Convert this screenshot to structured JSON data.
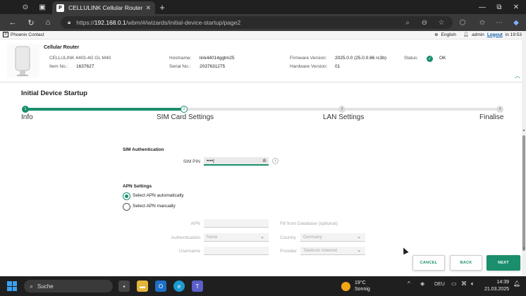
{
  "browser": {
    "tab_title": "CELLULINK Cellular Router",
    "tab_favicon": "P",
    "url_prefix": "https://",
    "url_host": "192.168.0.1",
    "url_path": "/wbm/#/wizards/initial-device-startup/page2"
  },
  "topbar": {
    "brand": "Phoenix Contact",
    "language": "English",
    "user": "admin",
    "logout": "Logout",
    "login_time": "in 19:53"
  },
  "device": {
    "title": "Cellular Router",
    "model": "CELLULINK 4403-4G GL M40",
    "item_label": "Item No.:",
    "item_value": "1637627",
    "hostname_label": "Hostname:",
    "hostname_value": "link44014ggtm25",
    "serial_label": "Serial No.:",
    "serial_value": "2037631275",
    "firmware_label": "Firmware Version:",
    "firmware_value": "2025.0.0 (25.0.0.86 rc3b)",
    "hardware_label": "Hardware Version:",
    "hardware_value": "01",
    "status_label": "Status:",
    "status_value": "OK"
  },
  "wizard": {
    "title": "Initial Device Startup",
    "progress_fraction": 0.333,
    "steps": [
      {
        "num": "1",
        "label": "Info"
      },
      {
        "num": "2",
        "label": "SIM Card Settings"
      },
      {
        "num": "3",
        "label": "LAN Settings"
      },
      {
        "num": "4",
        "label": "Finalise"
      }
    ]
  },
  "sim": {
    "section": "SIM Authentication",
    "pin_label": "SIM PIN",
    "pin_value": "••••|",
    "info": "i"
  },
  "apn": {
    "section": "APN Settings",
    "opt_auto": "Select APN automatically",
    "opt_manual": "Select APN manually",
    "apn_label": "APN",
    "apn_value": "",
    "fill_label": "Fill from Database (optional):",
    "auth_label": "Authentication",
    "auth_value": "None",
    "country_label": "Country",
    "country_value": "Germany",
    "username_label": "Username",
    "username_value": "",
    "provider_label": "Provider",
    "provider_value": "Telekom Internet"
  },
  "buttons": {
    "cancel": "CANCEL",
    "back": "BACK",
    "next": "NEXT"
  },
  "taskbar": {
    "search": "Suche",
    "weather_temp": "19°C",
    "weather_desc": "Sonnig",
    "lang": "DEU",
    "time": "14:39",
    "date": "21.03.2025"
  },
  "colors": {
    "accent": "#1a8e6d",
    "link": "#0b60a8"
  }
}
